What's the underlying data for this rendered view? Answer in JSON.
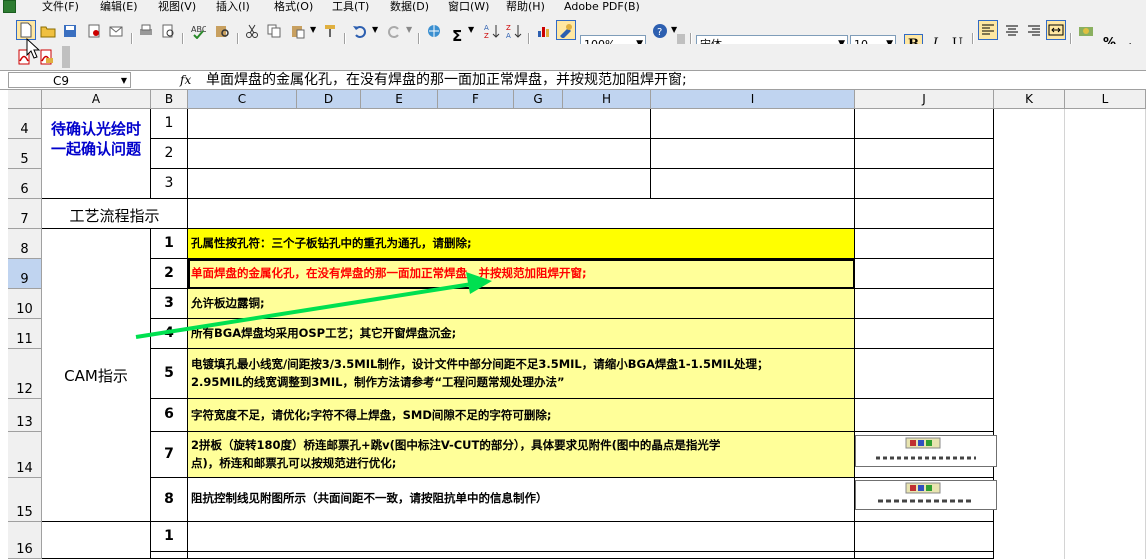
{
  "menu": [
    "文件(F)",
    "编辑(E)",
    "视图(V)",
    "插入(I)",
    "格式(O)",
    "工具(T)",
    "数据(D)",
    "窗口(W)",
    "帮助(H)",
    "Adobe PDF(B)"
  ],
  "toolbar": {
    "zoom": "100%",
    "font_name": "宋体",
    "font_size": "10",
    "bold": "B",
    "italic": "I",
    "underline": "U",
    "sigma": "Σ",
    "percent": "%"
  },
  "formula_bar": {
    "cell_ref": "C9",
    "fx": "fx",
    "content": "单面焊盘的金属化孔，在没有焊盘的那一面加正常焊盘，并按规范加阻焊开窗;"
  },
  "columns": [
    "A",
    "B",
    "C",
    "D",
    "E",
    "F",
    "G",
    "H",
    "I",
    "J",
    "K",
    "L"
  ],
  "rows": [
    "4",
    "5",
    "6",
    "7",
    "8",
    "9",
    "10",
    "11",
    "12",
    "13",
    "14",
    "15",
    "16"
  ],
  "confirm_note": {
    "line1": "待确认光绘时",
    "line2": "一起确认问题"
  },
  "confirm_numbers": [
    "1",
    "2",
    "3"
  ],
  "process_label": "工艺流程指示",
  "cam_label": "CAM指示",
  "cam_items": [
    {
      "num": "1",
      "text": "孔属性按孔符：三个子板钻孔中的重孔为通孔，请删除;",
      "line2": ""
    },
    {
      "num": "2",
      "text": "单面焊盘的金属化孔，在没有焊盘的那一面加正常焊盘，并按规范加阻焊开窗;",
      "line2": ""
    },
    {
      "num": "3",
      "text": "允许板边露铜;",
      "line2": ""
    },
    {
      "num": "4",
      "text": "所有BGA焊盘均采用OSP工艺；其它开窗焊盘沉金;",
      "line2": ""
    },
    {
      "num": "5",
      "text": "电镀填孔最小线宽/间距按3/3.5MIL制作，设计文件中部分间距不足3.5MIL，请缩小BGA焊盘1-1.5MIL处理；",
      "line2": "2.95MIL的线宽调整到3MIL，制作方法请参考“工程问题常规处理办法”"
    },
    {
      "num": "6",
      "text": "字符宽度不足，请优化;字符不得上焊盘，SMD间隙不足的字符可删除;",
      "line2": ""
    },
    {
      "num": "7",
      "text": "2拼板（旋转180度）桥连邮票孔+跳v(图中标注V-CUT的部分），具体要求见附件(图中的晶点是指光学",
      "line2": "点)，桥连和邮票孔可以按规范进行优化;"
    },
    {
      "num": "8",
      "text": "阻抗控制线见附图所示（共面间距不一致，请按阻抗单中的信息制作）",
      "line2": ""
    }
  ],
  "row16_num": "1",
  "colors": {
    "yellow": "#ffff00",
    "light_yellow": "#ffff99",
    "red_text": "#ff0000",
    "blue_text": "#0000cc",
    "arrow": "#00e050"
  }
}
